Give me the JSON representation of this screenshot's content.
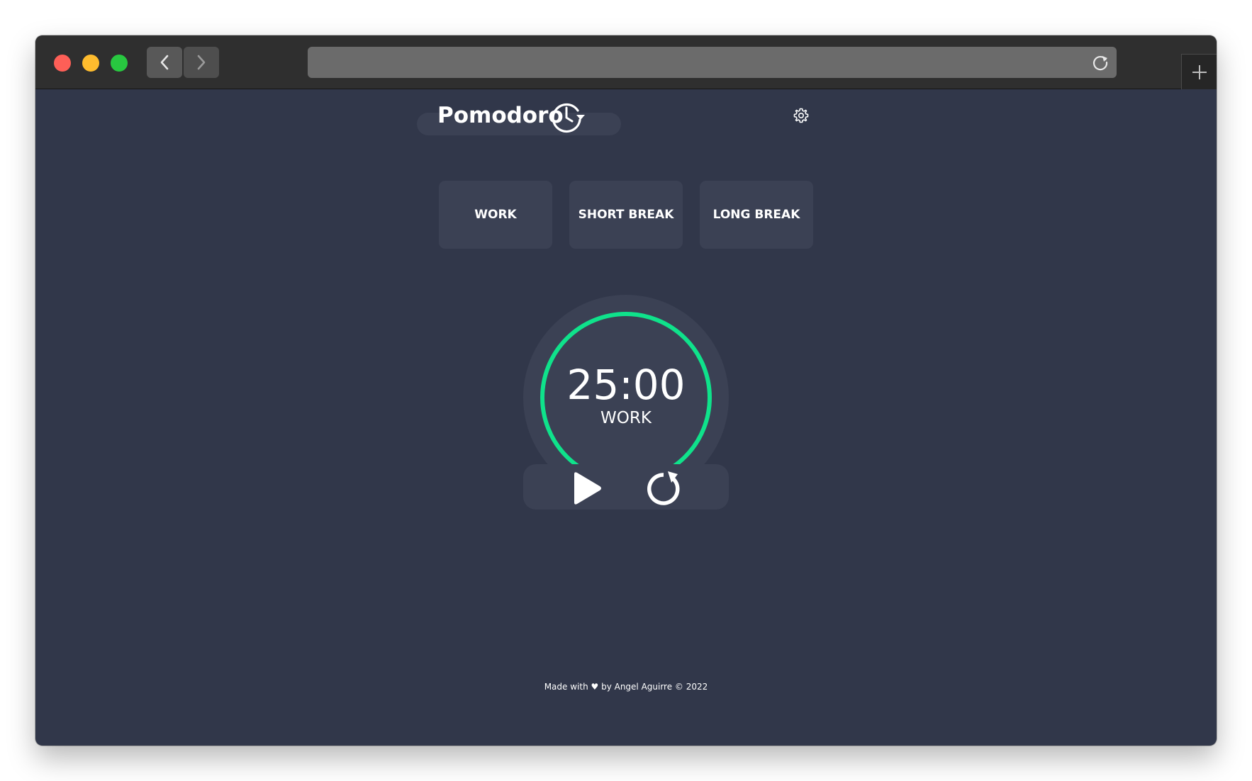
{
  "browser": {
    "back_icon": "chevron-left-icon",
    "forward_icon": "chevron-right-icon",
    "address_value": "",
    "reload_icon": "reload-icon",
    "new_tab_icon": "plus-icon"
  },
  "header": {
    "title": "Pomodoro",
    "logo_icon": "clock-refresh-icon",
    "settings_icon": "gear-icon"
  },
  "modes": [
    {
      "label": "WORK"
    },
    {
      "label": "SHORT BREAK"
    },
    {
      "label": "LONG BREAK"
    }
  ],
  "timer": {
    "time": "25:00",
    "mode": "WORK",
    "progress": 1.0,
    "ring_color": "#0fe28b"
  },
  "controls": {
    "play_icon": "play-icon",
    "reset_icon": "reset-icon"
  },
  "footer": {
    "text": "Made with ♥ by Angel Aguirre © 2022"
  },
  "colors": {
    "background": "#31374a",
    "surface": "#3b4154",
    "accent": "#0fe28b",
    "text": "#ffffff"
  }
}
